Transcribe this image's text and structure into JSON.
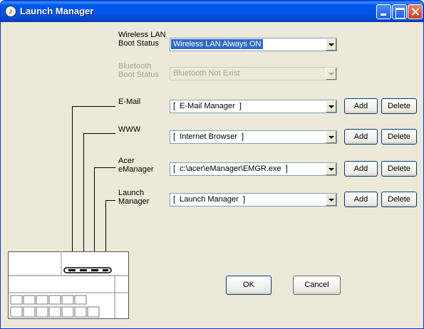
{
  "window": {
    "title": "Launch Manager",
    "app_icon": "launch-manager-icon"
  },
  "wireless": {
    "label_line1": "Wireless LAN",
    "label_line2": "Boot Status",
    "value": "Wireless LAN Always ON"
  },
  "bluetooth": {
    "label_line1": "Bluetooth",
    "label_line2": "Boot Status",
    "value": "Bluetooth Not Exist"
  },
  "rows": [
    {
      "label_line1": "E-Mail",
      "label_line2": "",
      "value": "[  E-Mail Manager  ]",
      "add": "Add",
      "delete": "Delete"
    },
    {
      "label_line1": "WWW",
      "label_line2": "",
      "value": "[  Internet Browser  ]",
      "add": "Add",
      "delete": "Delete"
    },
    {
      "label_line1": "Acer",
      "label_line2": "eManager",
      "value": "[  c:\\acer\\eManager\\EMGR.exe  ]",
      "add": "Add",
      "delete": "Delete"
    },
    {
      "label_line1": "Launch",
      "label_line2": "Manager",
      "value": "[  Launch Manager  ]",
      "add": "Add",
      "delete": "Delete"
    }
  ],
  "actions": {
    "ok": "OK",
    "cancel": "Cancel"
  },
  "colors": {
    "title_bar": "#0055e5",
    "dialog_bg": "#ece9d8",
    "selection": "#316ac5"
  }
}
